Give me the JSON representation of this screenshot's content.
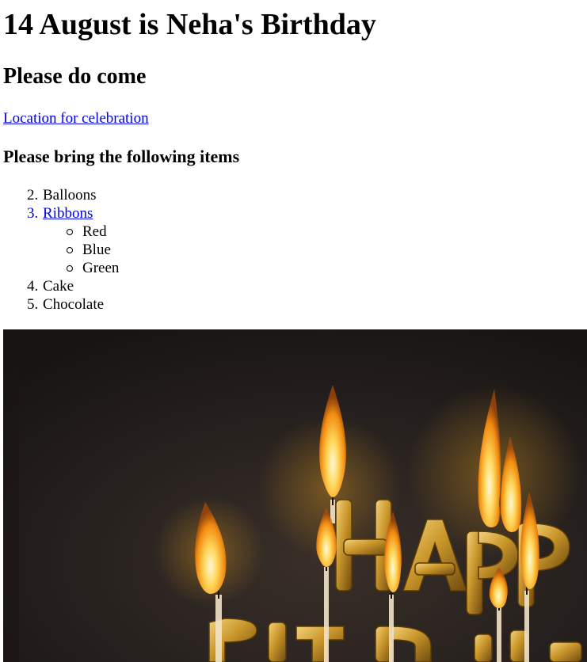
{
  "heading": "14 August is Neha's Birthday",
  "subheading": "Please do come",
  "location_link": "Location for celebration",
  "items_heading": "Please bring the following items",
  "items": [
    {
      "number": "2.",
      "label": "Balloons"
    },
    {
      "number": "3.",
      "label": "Ribbons",
      "sub": [
        "Red",
        "Blue",
        "Green"
      ]
    },
    {
      "number": "4.",
      "label": "Cake"
    },
    {
      "number": "5.",
      "label": "Chocolate"
    }
  ],
  "image": {
    "description_icon": "birthday-candles-photo",
    "letters": [
      "H",
      "A",
      "P",
      "P",
      "B",
      "I",
      "R",
      "T",
      "H"
    ]
  },
  "colors": {
    "link": "#0000ee",
    "text": "#000000",
    "photo_background": "#241f1d",
    "gold": "#c9962a",
    "flame": "#ffb020"
  }
}
